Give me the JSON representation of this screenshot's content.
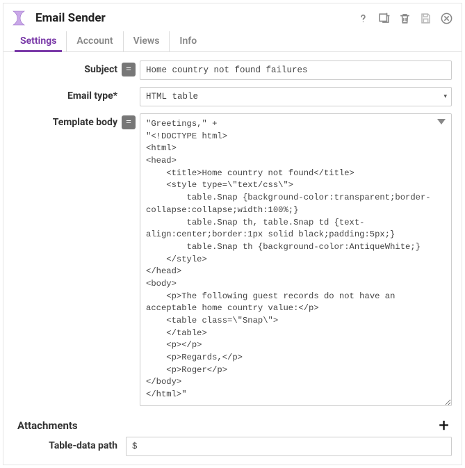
{
  "header": {
    "title": "Email Sender"
  },
  "tabs": [
    {
      "label": "Settings",
      "active": true
    },
    {
      "label": "Account",
      "active": false
    },
    {
      "label": "Views",
      "active": false
    },
    {
      "label": "Info",
      "active": false
    }
  ],
  "fields": {
    "subject": {
      "label": "Subject",
      "eq": "=",
      "value": "Home country not found failures"
    },
    "email_type": {
      "label": "Email type*",
      "value": "HTML table"
    },
    "template_body": {
      "label": "Template body",
      "eq": "=",
      "value": "\"Greetings,\" +\n\"<!DOCTYPE html>\n<html>\n<head>\n    <title>Home country not found</title>\n    <style type=\\\"text/css\\\">\n        table.Snap {background-color:transparent;border-collapse:collapse;width:100%;}\n        table.Snap th, table.Snap td {text-align:center;border:1px solid black;padding:5px;}\n        table.Snap th {background-color:AntiqueWhite;}\n    </style>\n</head>\n<body>\n    <p>The following guest records do not have an acceptable home country value:</p>\n    <table class=\\\"Snap\\\">\n    </table>\n    <p></p>\n    <p>Regards,</p>\n    <p>Roger</p>\n</body>\n</html>\""
    },
    "attachments": {
      "label": "Attachments"
    },
    "table_data_path": {
      "label": "Table-data path",
      "value": "$"
    }
  }
}
